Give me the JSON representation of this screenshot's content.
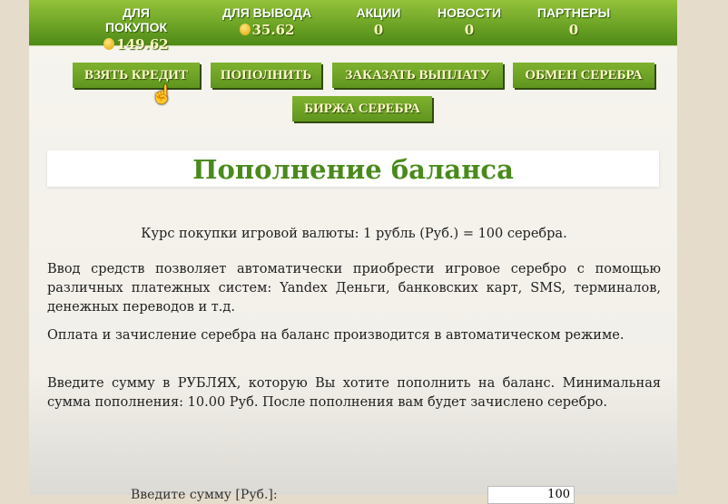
{
  "stats": [
    {
      "label": "ДЛЯ ПОКУПОК",
      "value": "149.62",
      "icon": "coins-icon"
    },
    {
      "label": "ДЛЯ ВЫВОДА",
      "value": "35.62",
      "icon": "coins-icon"
    },
    {
      "label": "АКЦИИ",
      "value": "0"
    },
    {
      "label": "НОВОСТИ",
      "value": "0"
    },
    {
      "label": "ПАРТНЕРЫ",
      "value": "0"
    }
  ],
  "buttons": {
    "credit": "ВЗЯТЬ КРЕДИТ",
    "topup": "ПОПОЛНИТЬ",
    "payout": "ЗАКАЗАТЬ ВЫПЛАТУ",
    "exchange": "ОБМЕН СЕРЕБРА",
    "market": "БИРЖА СЕРЕБРА"
  },
  "page_title": "Пополнение баланса",
  "paragraphs": [
    "Курс покупки игровой валюты: 1 рубль (Руб.) = 100 серебра.",
    "Ввод средств позволяет автоматически приобрести игровое серебро с помощью различных платежных систем: Yandex Деньги, банковских карт, SMS, терминалов, денежных переводов и т.д.",
    "Оплата и зачисление серебра на баланс производится в автоматическом режиме.",
    "Введите сумму в РУБЛЯХ, которую Вы хотите пополнить на баланс. Минимальная сумма пополнения: 10.00 Руб. После пополнения вам будет зачислено серебро."
  ],
  "form": {
    "amount_label": "Введите сумму [Руб.]:",
    "amount_value": "100"
  }
}
